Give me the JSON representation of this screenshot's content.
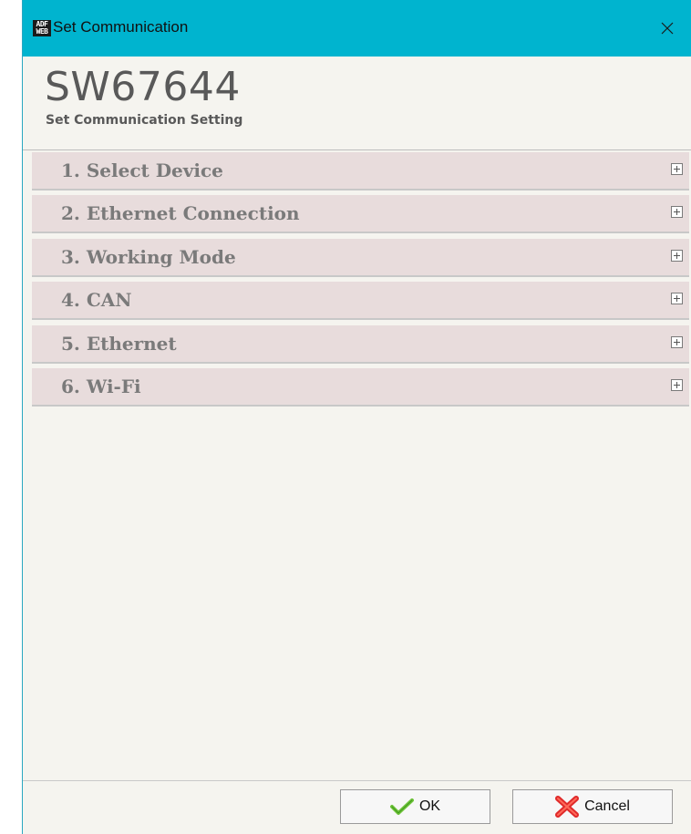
{
  "window": {
    "title": "Set Communication",
    "logo_text": "ADF WEB"
  },
  "header": {
    "title": "SW67644",
    "subtitle": "Set Communication Setting"
  },
  "sections": [
    {
      "label": "1. Select Device"
    },
    {
      "label": "2. Ethernet Connection"
    },
    {
      "label": "3. Working Mode"
    },
    {
      "label": "4. CAN"
    },
    {
      "label": "5. Ethernet"
    },
    {
      "label": "6. Wi-Fi"
    }
  ],
  "footer": {
    "ok_label": "OK",
    "cancel_label": "Cancel"
  },
  "colors": {
    "titlebar": "#00b4cf",
    "section_bg": "#e8dcdc",
    "window_bg": "#f5f4ef",
    "ok_icon": "#6fc33a",
    "cancel_icon": "#e02a2a"
  },
  "icons": {
    "close": "close-icon",
    "expand": "plus-box-icon",
    "ok": "checkmark-icon",
    "cancel": "x-icon"
  }
}
